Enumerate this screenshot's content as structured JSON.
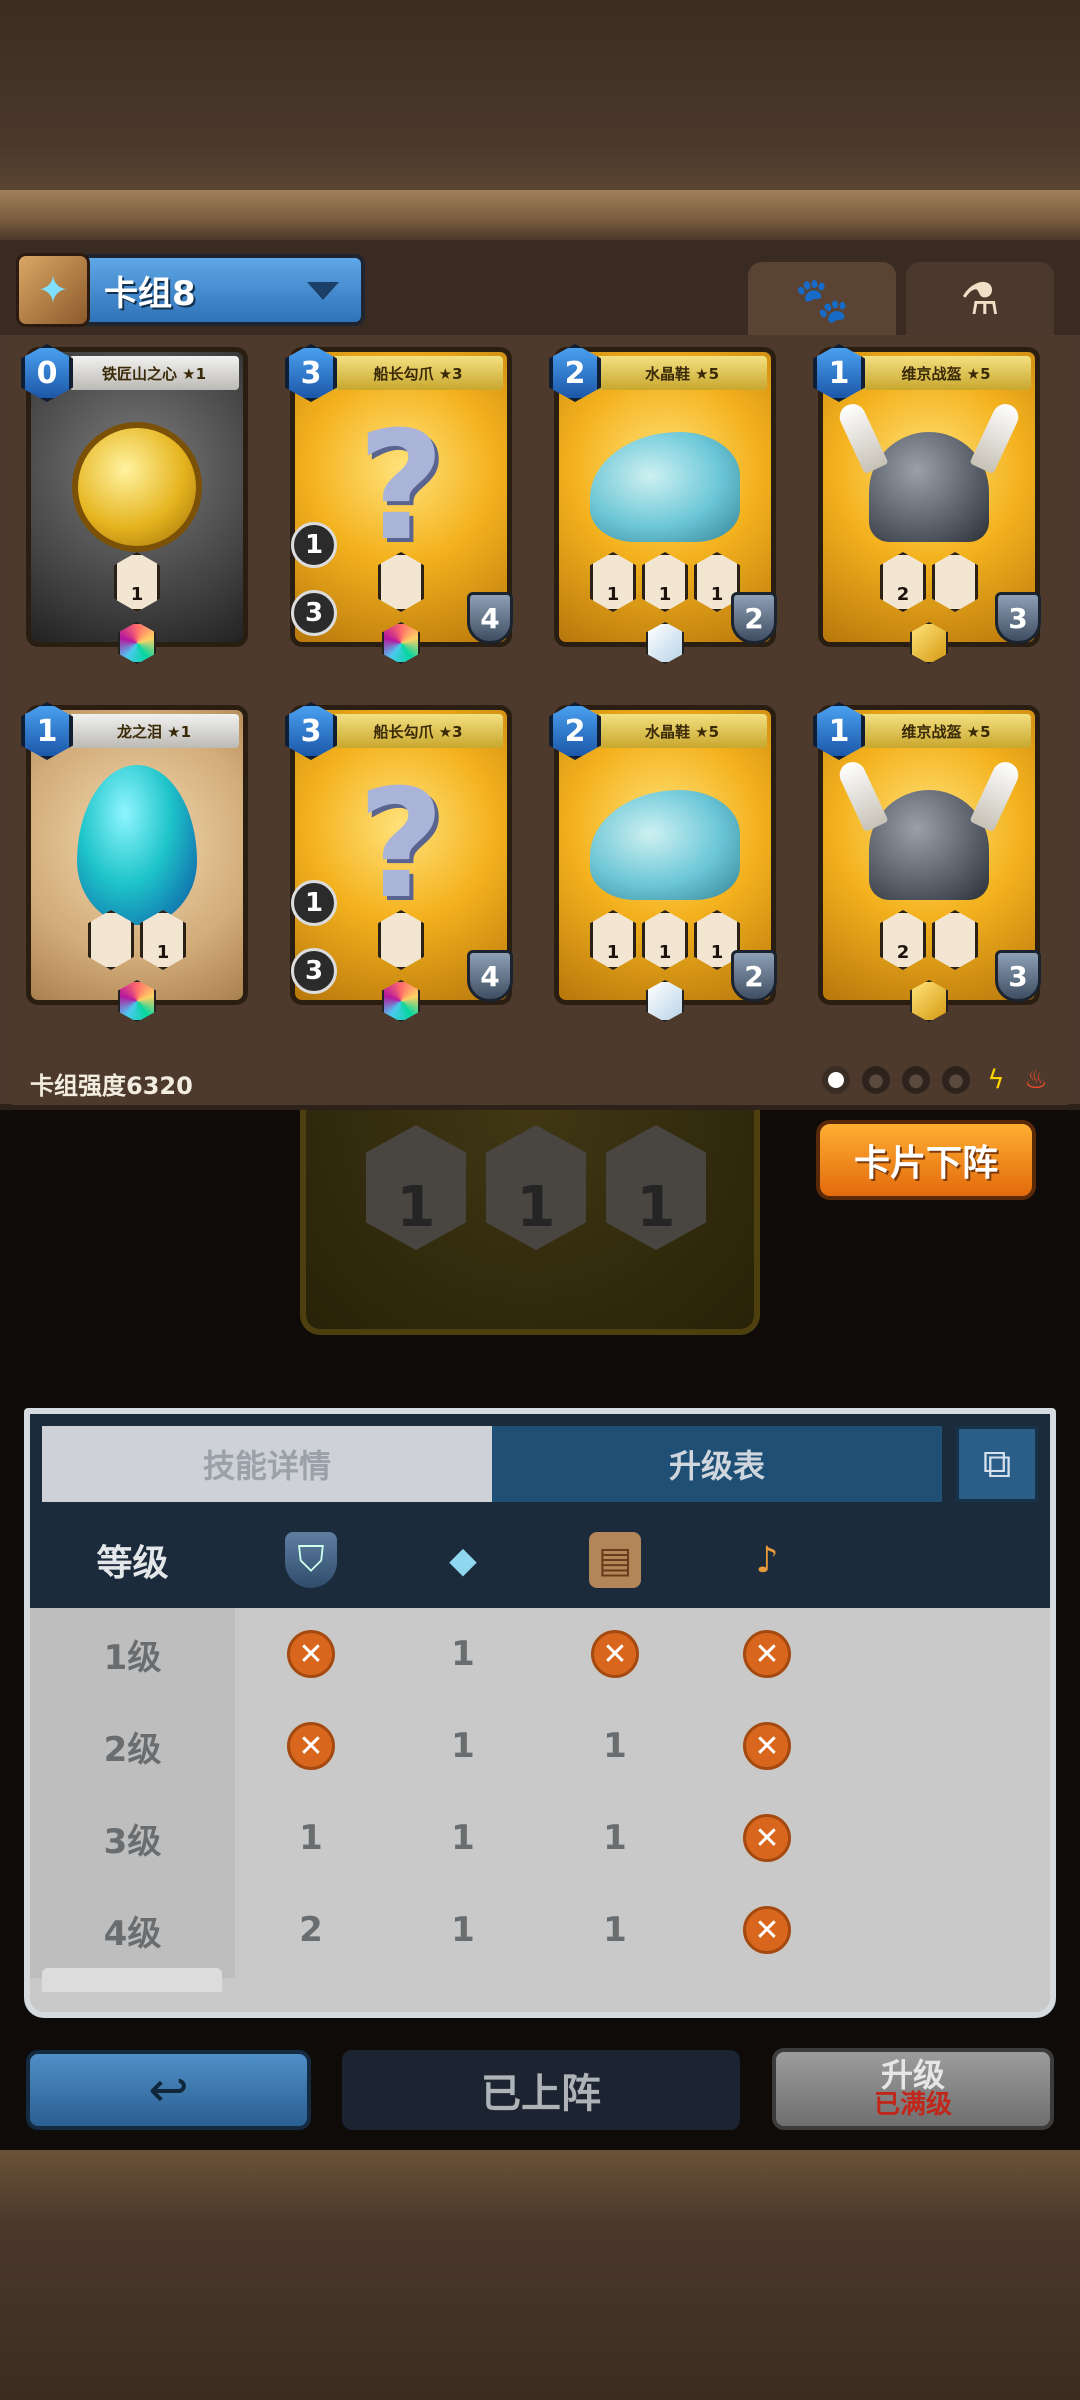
{
  "deck": {
    "name": "卡组8",
    "strength_label": "卡组强度6320",
    "tabs": [
      {
        "icon": "paw-icon",
        "glyph": "🐾"
      },
      {
        "icon": "potion-icon",
        "glyph": "⚗"
      }
    ]
  },
  "cards": [
    {
      "title": "铁匠山之心 ★1",
      "cost": "0",
      "style": "gray",
      "art": "coin",
      "gem": "rainbow",
      "reqs": [
        "1"
      ],
      "side": [],
      "level": ""
    },
    {
      "title": "船长勾爪 ★3",
      "cost": "3",
      "style": "gold",
      "art": "hook",
      "gem": "rainbow",
      "reqs": [
        ""
      ],
      "side": [
        "1",
        "3"
      ],
      "level": "4"
    },
    {
      "title": "水晶鞋 ★5",
      "cost": "2",
      "style": "gold",
      "art": "shoe",
      "gem": "ice",
      "reqs": [
        "1",
        "1",
        "1"
      ],
      "side": [],
      "level": "2"
    },
    {
      "title": "维京战盔 ★5",
      "cost": "1",
      "style": "gold",
      "art": "helmet",
      "gem": "gold",
      "reqs": [
        "2",
        ""
      ],
      "side": [],
      "level": "3"
    },
    {
      "title": "龙之泪 ★1",
      "cost": "1",
      "style": "tan",
      "art": "egg",
      "gem": "rainbow",
      "reqs": [
        "",
        "1"
      ],
      "side": [],
      "level": ""
    },
    {
      "title": "船长勾爪 ★3",
      "cost": "3",
      "style": "gold",
      "art": "hook",
      "gem": "rainbow",
      "reqs": [
        ""
      ],
      "side": [
        "1",
        "3"
      ],
      "level": "4"
    },
    {
      "title": "水晶鞋 ★5",
      "cost": "2",
      "style": "gold",
      "art": "shoe",
      "gem": "ice",
      "reqs": [
        "1",
        "1",
        "1"
      ],
      "side": [],
      "level": "2"
    },
    {
      "title": "维京战盔 ★5",
      "cost": "1",
      "style": "gold",
      "art": "helmet",
      "gem": "gold",
      "reqs": [
        "2",
        ""
      ],
      "side": [],
      "level": "3"
    }
  ],
  "detail_card": {
    "reqs": [
      "1",
      "1",
      "1"
    ],
    "level": "2"
  },
  "unequip_button": "卡片下阵",
  "tabs": {
    "skill": "技能详情",
    "upgrade": "升级表"
  },
  "table": {
    "level_header": "等级",
    "column_icons": [
      "shield-icon",
      "crystal-icon",
      "scroll-icon",
      "horn-icon"
    ],
    "rows": [
      {
        "level": "1级",
        "values": [
          "x",
          "1",
          "x",
          "x"
        ]
      },
      {
        "level": "2级",
        "values": [
          "x",
          "1",
          "1",
          "x"
        ]
      },
      {
        "level": "3级",
        "values": [
          "1",
          "1",
          "1",
          "x"
        ]
      },
      {
        "level": "4级",
        "values": [
          "2",
          "1",
          "1",
          "x"
        ]
      }
    ]
  },
  "buttons": {
    "back_icon": "↩",
    "equipped": "已上阵",
    "upgrade": "升级",
    "upgrade_status": "已满级"
  },
  "colors": {
    "accent_orange": "#e26a0c",
    "accent_blue": "#2f72b8",
    "card_gold": "#f4b21e"
  }
}
